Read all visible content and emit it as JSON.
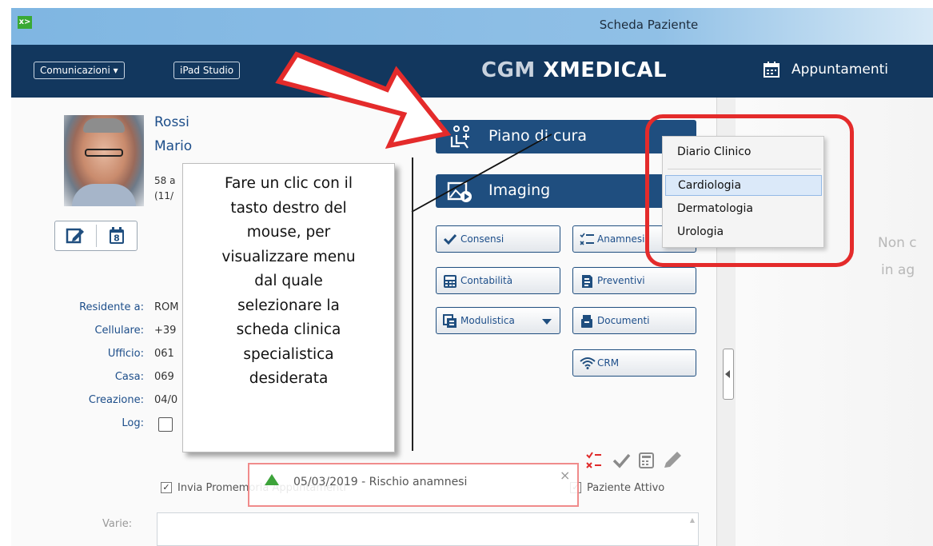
{
  "window": {
    "title": "Scheda Paziente",
    "app_icon_glyph": "x>"
  },
  "toolbar": {
    "communications_label": "Comunicazioni ▾",
    "ipad_label": "iPad Studio",
    "brand_left": "CGM",
    "brand_right": "XMEDICAL",
    "appointments_label": "Appuntamenti"
  },
  "patient": {
    "last_name": "Rossi",
    "first_name": "Mario",
    "age_fragment": "58 a",
    "birth_fragment": "(11/"
  },
  "fields": [
    {
      "label": "Residente a:",
      "value": "ROM"
    },
    {
      "label": "Cellulare:",
      "value": "+39"
    },
    {
      "label": "Ufficio:",
      "value": "061"
    },
    {
      "label": "Casa:",
      "value": "069"
    },
    {
      "label": "Creazione:",
      "value": "04/0"
    },
    {
      "label": "Log:",
      "value": ""
    }
  ],
  "actions": {
    "piano_di_cura": "Piano di cura",
    "imaging": "Imaging",
    "consensi": "Consensi",
    "anamnesi": "Anamnesi",
    "contabilita": "Contabilità",
    "preventivi": "Preventivi",
    "modulistica": "Modulistica",
    "documenti": "Documenti",
    "crm": "CRM"
  },
  "callout": {
    "lines": [
      "Fare un clic con il",
      "tasto destro del",
      "mouse, per",
      "visualizzare menu",
      "dal quale",
      "selezionare la",
      "scheda clinica",
      "specialistica",
      "desiderata"
    ]
  },
  "context_menu": {
    "items": [
      "Diario Clinico",
      "Cardiologia",
      "Dermatologia",
      "Urologia"
    ],
    "selected": "Cardiologia"
  },
  "checks": {
    "invia_promemoria": "Invia Promemoria Appuntamenti",
    "paziente_attivo": "Paziente Attivo"
  },
  "alert": {
    "text": "05/03/2019 - Rischio anamnesi",
    "close": "×"
  },
  "varie_label": "Varie:",
  "right_panel": {
    "line1": "Non c",
    "line2": "in ag"
  },
  "colors": {
    "navy": "#12375e",
    "button_blue": "#1f4e7f",
    "annotation_red": "#e42b2b",
    "alert_green": "#3da33a"
  }
}
